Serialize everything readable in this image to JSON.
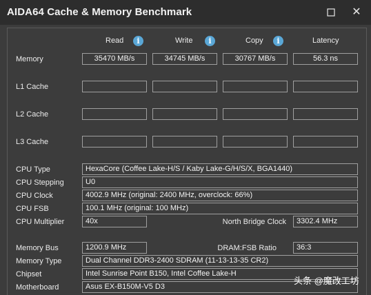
{
  "window": {
    "title": "AIDA64 Cache & Memory Benchmark",
    "close_label": "✕"
  },
  "columns": {
    "read": "Read",
    "write": "Write",
    "copy": "Copy",
    "latency": "Latency",
    "info_glyph": "i"
  },
  "rows": {
    "memory": {
      "label": "Memory",
      "read": "35470 MB/s",
      "write": "34745 MB/s",
      "copy": "30767 MB/s",
      "latency": "56.3 ns"
    },
    "l1": {
      "label": "L1 Cache",
      "read": "",
      "write": "",
      "copy": "",
      "latency": ""
    },
    "l2": {
      "label": "L2 Cache",
      "read": "",
      "write": "",
      "copy": "",
      "latency": ""
    },
    "l3": {
      "label": "L3 Cache",
      "read": "",
      "write": "",
      "copy": "",
      "latency": ""
    }
  },
  "cpu": {
    "type_label": "CPU Type",
    "type": "HexaCore  (Coffee Lake-H/S / Kaby Lake-G/H/S/X, BGA1440)",
    "stepping_label": "CPU Stepping",
    "stepping": "U0",
    "clock_label": "CPU Clock",
    "clock": "4002.9 MHz  (original: 2400 MHz, overclock: 66%)",
    "fsb_label": "CPU FSB",
    "fsb": "100.1 MHz  (original: 100 MHz)",
    "multiplier_label": "CPU Multiplier",
    "multiplier": "40x",
    "nb_clock_label": "North Bridge Clock",
    "nb_clock": "3302.4 MHz"
  },
  "memory_info": {
    "bus_label": "Memory Bus",
    "bus": "1200.9 MHz",
    "ratio_label": "DRAM:FSB Ratio",
    "ratio": "36:3",
    "type_label": "Memory Type",
    "type": "Dual Channel DDR3-2400 SDRAM  (11-13-13-35 CR2)",
    "chipset_label": "Chipset",
    "chipset": "Intel Sunrise Point B150, Intel Coffee Lake-H",
    "motherboard_label": "Motherboard",
    "motherboard": "Asus EX-B150M-V5 D3"
  },
  "watermark": "头条 @魔改工坊",
  "colors": {
    "background": "#3c3c3c",
    "titlebar": "#2d2d2d",
    "info_icon": "#5aa7d6",
    "field_border": "#a0a0a0"
  }
}
